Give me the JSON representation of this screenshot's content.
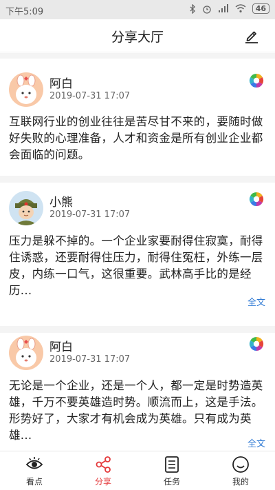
{
  "status_bar": {
    "time": "下午5:09",
    "battery": "46",
    "icons": [
      "bluetooth-icon",
      "alarm-icon",
      "signal-icon",
      "wifi-icon",
      "battery-icon"
    ]
  },
  "header": {
    "title": "分享大厅",
    "edit_icon": "edit-pen-icon"
  },
  "posts": [
    {
      "user": "阿白",
      "time": "2019-07-31 17:07",
      "avatar": "bunny-avatar",
      "content": "互联网行业的创业往往是苦尽甘不来的，要随时做好失败的心理准备，人才和资金是所有创业企业都会面临的问题。",
      "more_label": ""
    },
    {
      "user": "小熊",
      "time": "2019-07-31 17:07",
      "avatar": "soldier-avatar",
      "content": "压力是躲不掉的。一个企业家要耐得住寂寞，耐得住诱惑，还要耐得住压力，耐得住冤枉，外练一层皮，内练一口气，这很重要。武林高手比的是经历...",
      "more_label": "全文"
    },
    {
      "user": "阿白",
      "time": "2019-07-31 17:07",
      "avatar": "bunny-avatar",
      "content": "无论是一个企业，还是一个人，都一定是时势造英雄，千万不要英雄造时势。顺流而上，这是手法。形势好了，大家才有机会成为英雄。只有成为英雄...",
      "more_label": "全文"
    }
  ],
  "bottom_nav": [
    {
      "label": "看点",
      "icon": "eye-icon",
      "active": false
    },
    {
      "label": "分享",
      "icon": "share-icon",
      "active": true
    },
    {
      "label": "任务",
      "icon": "task-list-icon",
      "active": false
    },
    {
      "label": "我的",
      "icon": "smiley-icon",
      "active": false
    }
  ],
  "colors": {
    "accent": "#e4383a",
    "link": "#2f7ad4",
    "background": "#f4f4f4"
  }
}
